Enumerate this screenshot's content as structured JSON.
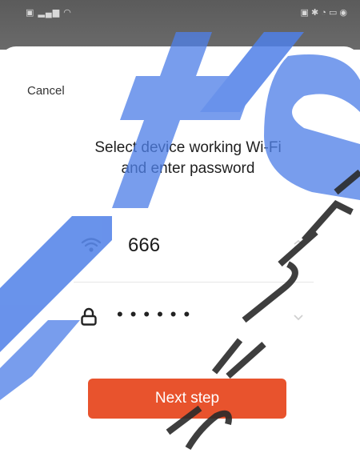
{
  "header": {
    "cancel_label": "Cancel"
  },
  "dialog": {
    "title_line1": "Select device working Wi-Fi",
    "title_line2": "and enter password"
  },
  "wifi": {
    "ssid": "666",
    "password_mask": "••••••",
    "icon": "wifi-icon",
    "lock_icon": "lock-icon",
    "chevron_icon": "chevron-down-icon"
  },
  "actions": {
    "next_label": "Next step"
  },
  "watermark": {
    "text": "TI-SE SECURITY SYST"
  },
  "colors": {
    "accent": "#e8532d",
    "watermark_blue": "#4f80e8",
    "status_bar": "#5f5f5f"
  }
}
